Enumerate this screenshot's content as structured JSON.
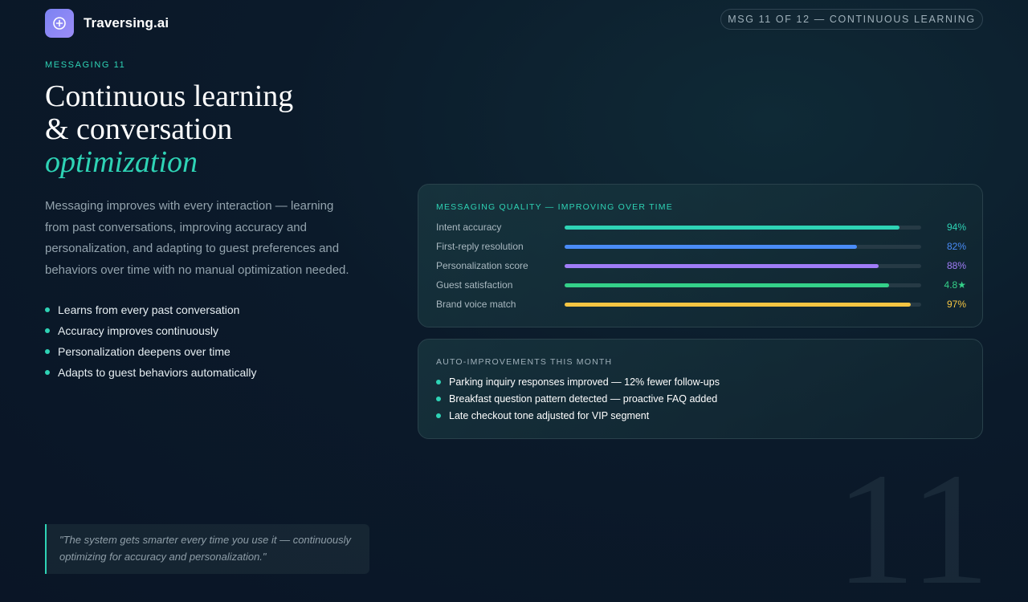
{
  "brand": {
    "name": "Traversing.ai",
    "logo_icon": "plus-circle-icon"
  },
  "header": {
    "pill": "MSG 11 OF 12 — CONTINUOUS LEARNING"
  },
  "hero": {
    "eyebrow": "MESSAGING 11",
    "headline": [
      "Continuous learning",
      "& conversation",
      "optimization"
    ],
    "description": "Messaging improves with every interaction — learning from past conversations, improving accuracy and personalization, and adapting to guest preferences and behaviors over time with no manual optimization needed.",
    "bullets": [
      "Learns from every past conversation",
      "Accuracy improves continuously",
      "Personalization deepens over time",
      "Adapts to guest behaviors automatically"
    ]
  },
  "quality_card": {
    "title": "MESSAGING QUALITY — IMPROVING OVER TIME",
    "metrics": [
      {
        "label": "Intent accuracy",
        "value_text": "94%",
        "fill": 0.94,
        "color": "#2ed3b5"
      },
      {
        "label": "First-reply resolution",
        "value_text": "82%",
        "fill": 0.82,
        "color": "#4a8cf7"
      },
      {
        "label": "Personalization score",
        "value_text": "88%",
        "fill": 0.88,
        "color": "#a07cf7"
      },
      {
        "label": "Guest satisfaction",
        "value_text": "4.8★",
        "fill": 0.91,
        "color": "#34d189"
      },
      {
        "label": "Brand voice match",
        "value_text": "97%",
        "fill": 0.97,
        "color": "#f5c542"
      }
    ]
  },
  "improve_card": {
    "title": "AUTO-IMPROVEMENTS THIS MONTH",
    "items": [
      "Parking inquiry responses improved — 12% fewer follow-ups",
      "Breakfast question pattern detected — proactive FAQ added",
      "Late checkout tone adjusted for VIP segment"
    ]
  },
  "quote": "\"The system gets smarter every time you use it — continuously optimizing for accuracy and personalization.\"",
  "background_number": "11",
  "colors": {
    "accent": "#2ed3b5",
    "background": "#0b1a2a"
  }
}
